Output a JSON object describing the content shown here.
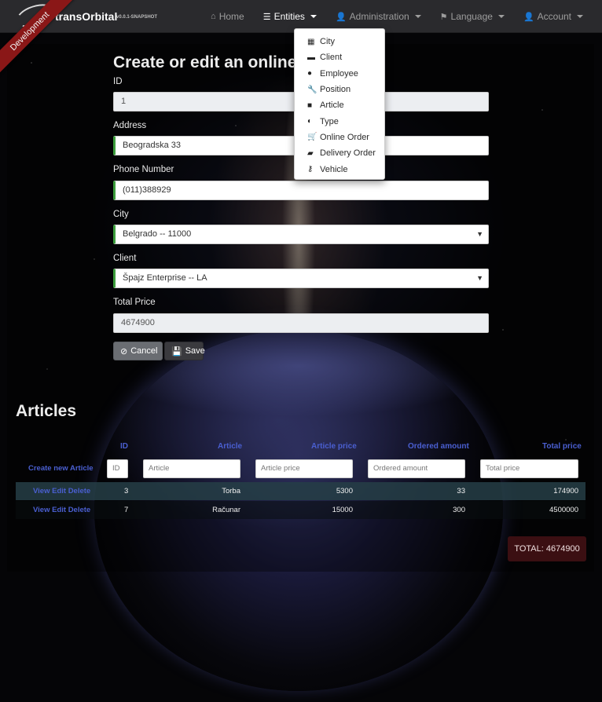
{
  "brand": {
    "name": "transOrbital",
    "version": "v0.0.1-SNAPSHOT",
    "ribbon": "Development"
  },
  "nav": {
    "items": [
      {
        "label": "Home",
        "icon": "home-icon"
      },
      {
        "label": "Entities",
        "icon": "list-icon"
      },
      {
        "label": "Administration",
        "icon": "user-plus-icon"
      },
      {
        "label": "Language",
        "icon": "flag-icon"
      },
      {
        "label": "Account",
        "icon": "user-icon"
      }
    ]
  },
  "entities_menu": {
    "items": [
      {
        "label": "City",
        "icon": "building-icon"
      },
      {
        "label": "Client",
        "icon": "briefcase-icon"
      },
      {
        "label": "Employee",
        "icon": "user-icon"
      },
      {
        "label": "Position",
        "icon": "wrench-icon"
      },
      {
        "label": "Article",
        "icon": "shopping-bag-icon"
      },
      {
        "label": "Type",
        "icon": "adjust-icon"
      },
      {
        "label": "Online Order",
        "icon": "shopping-cart-icon"
      },
      {
        "label": "Delivery Order",
        "icon": "truck-icon"
      },
      {
        "label": "Vehicle",
        "icon": "key-icon"
      }
    ]
  },
  "form": {
    "title": "Create or edit an online",
    "id_label": "ID",
    "id_value": "1",
    "address_label": "Address",
    "address_value": "Beogradska 33",
    "phone_label": "Phone Number",
    "phone_value": "(011)388929",
    "city_label": "City",
    "city_value": "Belgrado -- 11000",
    "client_label": "Client",
    "client_value": "Špajz Enterprise -- LA",
    "total_label": "Total Price",
    "total_value": "4674900",
    "cancel_label": "Cancel",
    "save_label": "Save"
  },
  "articles": {
    "title": "Articles",
    "create_link": "Create new Article",
    "columns": [
      "ID",
      "Article",
      "Article price",
      "Ordered amount",
      "Total price"
    ],
    "filters": [
      "ID",
      "Article",
      "Article price",
      "Ordered amount",
      "Total price"
    ],
    "rows": [
      {
        "actions": "View Edit Delete",
        "id": "3",
        "article": "Torba",
        "price": "5300",
        "amount": "33",
        "total": "174900"
      },
      {
        "actions": "View Edit Delete",
        "id": "7",
        "article": "Računar",
        "price": "15000",
        "amount": "300",
        "total": "4500000"
      }
    ],
    "total": "TOTAL: 4674900"
  },
  "colors": {
    "link": "#4a5fd1",
    "valid_border": "#3c9d3c",
    "ribbon": "#8a1717",
    "navbar": "#2a2a2d"
  }
}
